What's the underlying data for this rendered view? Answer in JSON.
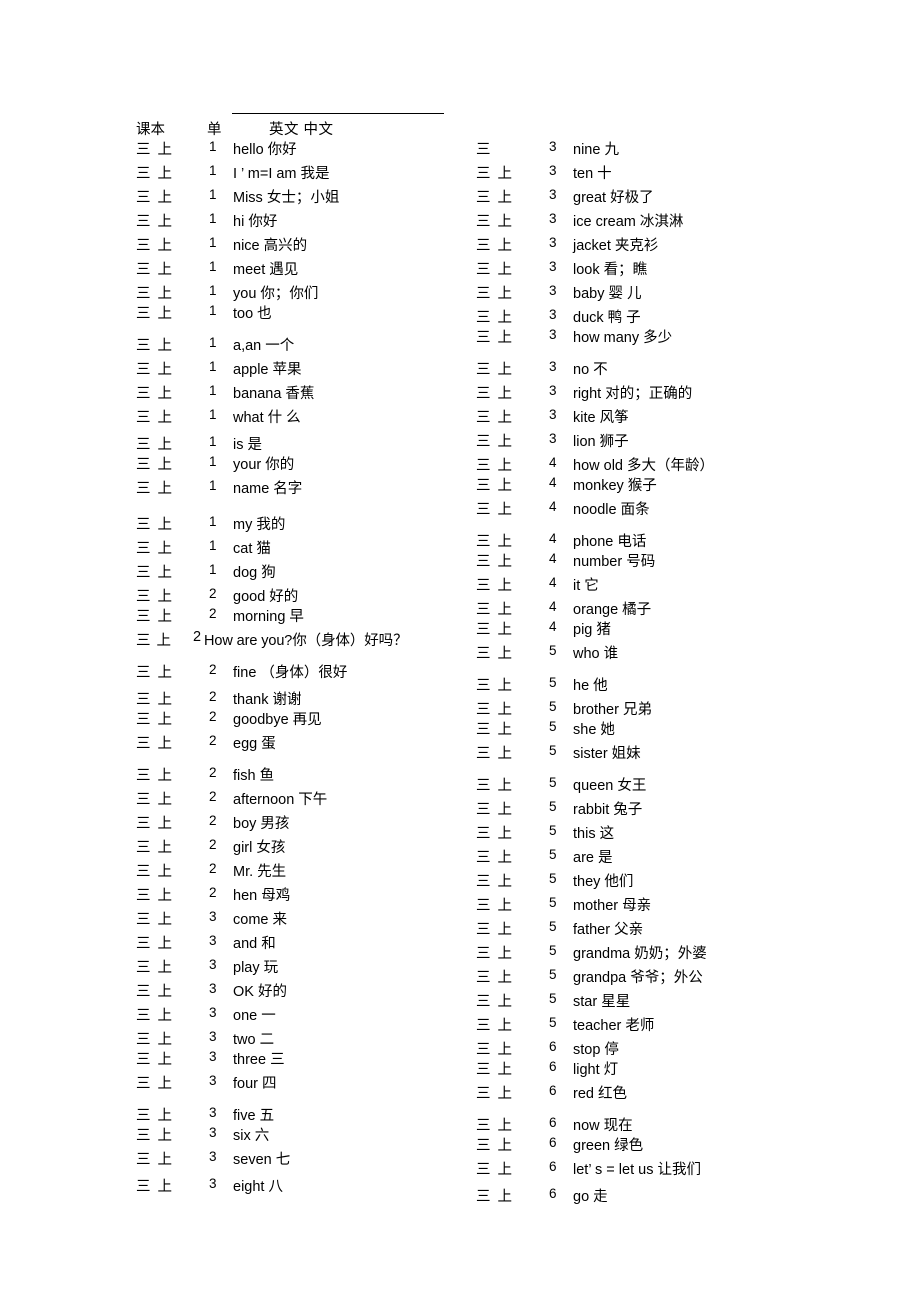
{
  "header": {
    "book_label": "课本",
    "unit_label": "单",
    "word_label": "英文 中文"
  },
  "left_column": [
    {
      "book": "三 上",
      "unit": "1",
      "word": "hello 你好",
      "gap": ""
    },
    {
      "book": "三 上",
      "unit": "1",
      "word": "I ’  m=I am 我是",
      "gap": ""
    },
    {
      "book": "三 上",
      "unit": "1",
      "word": "Miss 女士；小姐",
      "gap": ""
    },
    {
      "book": "三 上",
      "unit": "1",
      "word": "hi 你好",
      "gap": ""
    },
    {
      "book": "三 上",
      "unit": "1",
      "word": "nice 高兴的",
      "gap": ""
    },
    {
      "book": "三 上",
      "unit": "1",
      "word": "meet 遇见",
      "gap": ""
    },
    {
      "book": "三 上",
      "unit": "1",
      "word": "you 你；你们",
      "gap": ""
    },
    {
      "book": "三 上",
      "unit": "1",
      "word": "too 也",
      "gap": "tight"
    },
    {
      "book": "三 上",
      "unit": "1",
      "word": "a,an 一个",
      "gap": "gap-md"
    },
    {
      "book": "三 上",
      "unit": "1",
      "word": "apple 苹果",
      "gap": ""
    },
    {
      "book": "三 上",
      "unit": "1",
      "word": "banana 香蕉",
      "gap": ""
    },
    {
      "book": "三 上",
      "unit": "1",
      "word": "what 什 么",
      "gap": ""
    },
    {
      "book": "三 上",
      "unit": "1",
      "word": "is 是",
      "gap": "gap-sm"
    },
    {
      "book": "三 上",
      "unit": "1",
      "word": "your 你的",
      "gap": "tight"
    },
    {
      "book": "三 上",
      "unit": "1",
      "word": "name 名字",
      "gap": ""
    },
    {
      "book": "三 上",
      "unit": "1",
      "word": "my 我的",
      "gap": "gap-lg"
    },
    {
      "book": "三 上",
      "unit": "1",
      "word": "cat 猫",
      "gap": ""
    },
    {
      "book": "三 上",
      "unit": "1",
      "word": "dog 狗",
      "gap": ""
    },
    {
      "book": "三 上",
      "unit": "2",
      "word": "good 好的",
      "gap": ""
    },
    {
      "book": "三 上",
      "unit": "2",
      "word": "morning 早",
      "gap": "tight"
    },
    {
      "book": "三 上",
      "unit": "2",
      "word": "How are you?你（身体）好吗？",
      "gap": "",
      "style": "inline"
    },
    {
      "book": "三 上",
      "unit": "2",
      "word": "fine （身体）很好",
      "gap": "gap-md"
    },
    {
      "book": "三 上",
      "unit": "2",
      "word": "thank 谢谢",
      "gap": "gap-sm"
    },
    {
      "book": "三 上",
      "unit": "2",
      "word": "goodbye 再见",
      "gap": "tight"
    },
    {
      "book": "三 上",
      "unit": "2",
      "word": "egg 蛋",
      "gap": ""
    },
    {
      "book": "三 上",
      "unit": "2",
      "word": "fish 鱼",
      "gap": "gap-md"
    },
    {
      "book": "三 上",
      "unit": "2",
      "word": "afternoon 下午",
      "gap": ""
    },
    {
      "book": "三 上",
      "unit": "2",
      "word": "boy 男孩",
      "gap": ""
    },
    {
      "book": "三 上",
      "unit": "2",
      "word": "girl 女孩",
      "gap": ""
    },
    {
      "book": "三 上",
      "unit": "2",
      "word": "Mr. 先生",
      "gap": ""
    },
    {
      "book": "三 上",
      "unit": "2",
      "word": "hen 母鸡",
      "gap": ""
    },
    {
      "book": "三 上",
      "unit": "3",
      "word": "come 来",
      "gap": ""
    },
    {
      "book": "三 上",
      "unit": "3",
      "word": "and 和",
      "gap": ""
    },
    {
      "book": "三 上",
      "unit": "3",
      "word": "play 玩",
      "gap": ""
    },
    {
      "book": "三 上",
      "unit": "3",
      "word": "OK 好的",
      "gap": ""
    },
    {
      "book": "三 上",
      "unit": "3",
      "word": "one 一",
      "gap": ""
    },
    {
      "book": "三 上",
      "unit": "3",
      "word": "two 二",
      "gap": ""
    },
    {
      "book": "三 上",
      "unit": "3",
      "word": "three 三",
      "gap": "tight"
    },
    {
      "book": "三 上",
      "unit": "3",
      "word": "four 四",
      "gap": ""
    },
    {
      "book": "三 上",
      "unit": "3",
      "word": "five 五",
      "gap": "gap-md"
    },
    {
      "book": "三 上",
      "unit": "3",
      "word": "six 六",
      "gap": "tight"
    },
    {
      "book": "三 上",
      "unit": "3",
      "word": "seven 七",
      "gap": ""
    },
    {
      "book": "三 上",
      "unit": "3",
      "word": "eight 八",
      "gap": "gap-sm"
    }
  ],
  "right_column": [
    {
      "book": "三",
      "unit": "3",
      "word": "nine 九",
      "gap": ""
    },
    {
      "book": "三 上",
      "unit": "3",
      "word": "ten 十",
      "gap": ""
    },
    {
      "book": "三 上",
      "unit": "3",
      "word": "great 好极了",
      "gap": ""
    },
    {
      "book": "三 上",
      "unit": "3",
      "word": "ice cream 冰淇淋",
      "gap": ""
    },
    {
      "book": "三 上",
      "unit": "3",
      "word": "jacket 夹克衫",
      "gap": ""
    },
    {
      "book": "三 上",
      "unit": "3",
      "word": "look 看；瞧",
      "gap": ""
    },
    {
      "book": "三 上",
      "unit": "3",
      "word": "baby 婴 儿",
      "gap": ""
    },
    {
      "book": "三 上",
      "unit": "3",
      "word": "duck 鸭 子",
      "gap": ""
    },
    {
      "book": "三 上",
      "unit": "3",
      "word": "how many 多少",
      "gap": "tight"
    },
    {
      "book": "三 上",
      "unit": "3",
      "word": "no 不",
      "gap": "gap-md"
    },
    {
      "book": "三 上",
      "unit": "3",
      "word": "right 对的；正确的",
      "gap": ""
    },
    {
      "book": "三 上",
      "unit": "3",
      "word": "kite 风筝",
      "gap": ""
    },
    {
      "book": "三 上",
      "unit": "3",
      "word": "lion 狮子",
      "gap": ""
    },
    {
      "book": "三 上",
      "unit": "4",
      "word": "how old 多大（年龄）",
      "gap": ""
    },
    {
      "book": "三 上",
      "unit": "4",
      "word": "monkey 猴子",
      "gap": "tight"
    },
    {
      "book": "三 上",
      "unit": "4",
      "word": "noodle 面条",
      "gap": ""
    },
    {
      "book": "三 上",
      "unit": "4",
      "word": "phone 电话",
      "gap": "gap-md"
    },
    {
      "book": "三 上",
      "unit": "4",
      "word": "number 号码",
      "gap": "tight"
    },
    {
      "book": "三 上",
      "unit": "4",
      "word": "it 它",
      "gap": ""
    },
    {
      "book": "三 上",
      "unit": "4",
      "word": "orange 橘子",
      "gap": ""
    },
    {
      "book": "三 上",
      "unit": "4",
      "word": "pig 猪",
      "gap": "tight"
    },
    {
      "book": "三 上",
      "unit": "5",
      "word": "who 谁",
      "gap": ""
    },
    {
      "book": "三 上",
      "unit": "5",
      "word": "he 他",
      "gap": "gap-md"
    },
    {
      "book": "三 上",
      "unit": "5",
      "word": "brother 兄弟",
      "gap": ""
    },
    {
      "book": "三 上",
      "unit": "5",
      "word": "she 她",
      "gap": "tight"
    },
    {
      "book": "三 上",
      "unit": "5",
      "word": "sister 姐妹",
      "gap": ""
    },
    {
      "book": "三 上",
      "unit": "5",
      "word": "queen 女王",
      "gap": "gap-md"
    },
    {
      "book": "三 上",
      "unit": "5",
      "word": "rabbit 兔子",
      "gap": ""
    },
    {
      "book": "三 上",
      "unit": "5",
      "word": "this 这",
      "gap": ""
    },
    {
      "book": "三 上",
      "unit": "5",
      "word": "are 是",
      "gap": ""
    },
    {
      "book": "三 上",
      "unit": "5",
      "word": "they 他们",
      "gap": ""
    },
    {
      "book": "三 上",
      "unit": "5",
      "word": "mother 母亲",
      "gap": ""
    },
    {
      "book": "三 上",
      "unit": "5",
      "word": "father 父亲",
      "gap": ""
    },
    {
      "book": "三 上",
      "unit": "5",
      "word": "grandma 奶奶；外婆",
      "gap": ""
    },
    {
      "book": "三 上",
      "unit": "5",
      "word": "grandpa 爷爷；外公",
      "gap": ""
    },
    {
      "book": "三 上",
      "unit": "5",
      "word": "star 星星",
      "gap": ""
    },
    {
      "book": "三 上",
      "unit": "5",
      "word": "teacher 老师",
      "gap": ""
    },
    {
      "book": "三 上",
      "unit": "6",
      "word": "stop 停",
      "gap": ""
    },
    {
      "book": "三 上",
      "unit": "6",
      "word": "light 灯",
      "gap": "tight"
    },
    {
      "book": "三 上",
      "unit": "6",
      "word": "red 红色",
      "gap": ""
    },
    {
      "book": "三 上",
      "unit": "6",
      "word": "now 现在",
      "gap": "gap-md"
    },
    {
      "book": "三 上",
      "unit": "6",
      "word": "green 绿色",
      "gap": "tight"
    },
    {
      "book": "三 上",
      "unit": "6",
      "word": "let’  s = let us 让我们",
      "gap": ""
    },
    {
      "book": "三 上",
      "unit": "6",
      "word": "go 走",
      "gap": "gap-sm"
    }
  ]
}
